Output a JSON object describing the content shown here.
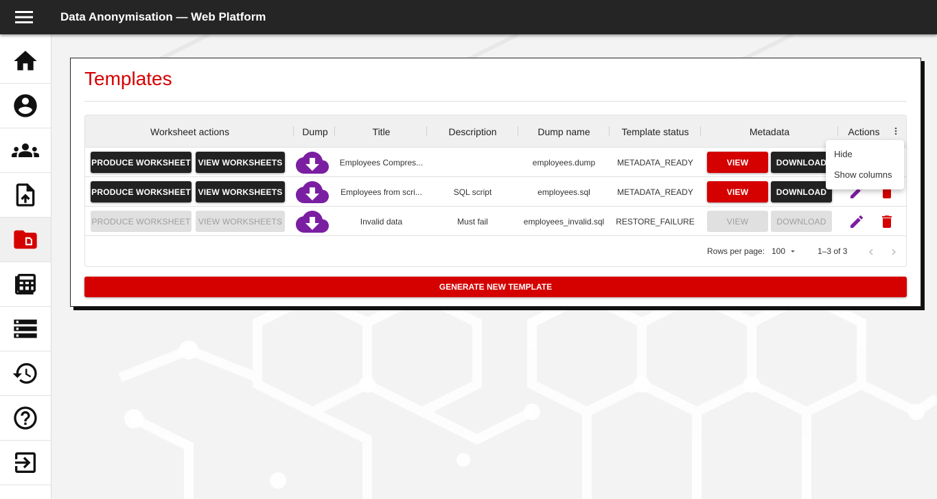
{
  "app": {
    "title": "Data Anonymisation — Web Platform"
  },
  "sidebar": {
    "items": [
      {
        "icon": "home-icon",
        "active": false
      },
      {
        "icon": "account-icon",
        "active": false
      },
      {
        "icon": "users-icon",
        "active": false
      },
      {
        "icon": "upload-file-icon",
        "active": false
      },
      {
        "icon": "templates-folder-icon",
        "active": true
      },
      {
        "icon": "worksheets-icon",
        "active": false
      },
      {
        "icon": "storage-icon",
        "active": false
      },
      {
        "icon": "history-icon",
        "active": false
      },
      {
        "icon": "help-icon",
        "active": false
      },
      {
        "icon": "logout-icon",
        "active": false
      }
    ]
  },
  "page": {
    "title": "Templates"
  },
  "table": {
    "columns": [
      "Worksheet actions",
      "Dump",
      "Title",
      "Description",
      "Dump name",
      "Template status",
      "Metadata",
      "Actions"
    ],
    "rows": [
      {
        "produce_label": "PRODUCE WORKSHEET",
        "view_ws_label": "VIEW WORKSHEETS",
        "title": "Employees Compres...",
        "description": "",
        "dump_name": "employees.dump",
        "status": "METADATA_READY",
        "view_label": "VIEW",
        "download_label": "DOWNLOAD",
        "enabled": true
      },
      {
        "produce_label": "PRODUCE WORKSHEET",
        "view_ws_label": "VIEW WORKSHEETS",
        "title": "Employees from scri...",
        "description": "SQL script",
        "dump_name": "employees.sql",
        "status": "METADATA_READY",
        "view_label": "VIEW",
        "download_label": "DOWNLOAD",
        "enabled": true
      },
      {
        "produce_label": "PRODUCE WORKSHEET",
        "view_ws_label": "VIEW WORKSHEETS",
        "title": "Invalid data",
        "description": "Must fail",
        "dump_name": "employees_invalid.sql",
        "status": "RESTORE_FAILURE",
        "view_label": "VIEW",
        "download_label": "DOWNLOAD",
        "enabled": false
      }
    ],
    "footer": {
      "rows_per_page_label": "Rows per page:",
      "rows_per_page_value": "100",
      "range": "1–3 of 3"
    }
  },
  "column_menu": {
    "items": [
      "Hide",
      "Show columns"
    ]
  },
  "generate_button": "GENERATE NEW TEMPLATE",
  "colors": {
    "accent": "#d50000",
    "dump_icon": "#7b1fa2",
    "topbar": "#252525",
    "dark_button": "#222222"
  }
}
